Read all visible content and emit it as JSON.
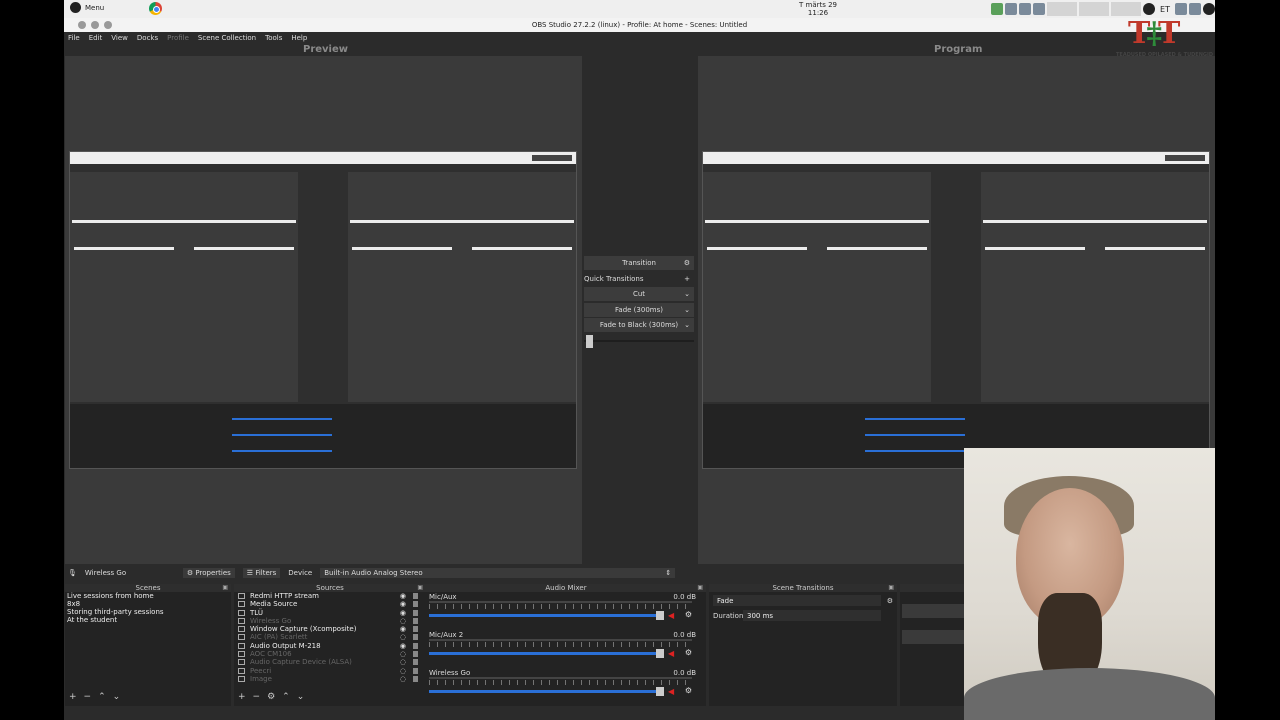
{
  "topbar": {
    "menu_label": "Menu",
    "clock_date": "T märts 29",
    "clock_time": "11:26",
    "lang": "ET"
  },
  "window": {
    "title": "OBS Studio 27.2.2 (linux) - Profile: At home - Scenes: Untitled"
  },
  "menu": [
    "File",
    "Edit",
    "View",
    "Docks",
    "Profile",
    "Scene Collection",
    "Tools",
    "Help"
  ],
  "labels": {
    "preview": "Preview",
    "program": "Program"
  },
  "transition_panel": {
    "transition": "Transition",
    "quick_transitions": "Quick Transitions",
    "cut": "Cut",
    "fade": "Fade (300ms)",
    "fade_black": "Fade to Black (300ms)"
  },
  "source_bar": {
    "source_name": "Wireless Go",
    "properties": "Properties",
    "filters": "Filters",
    "device_label": "Device",
    "device_value": "Built-in Audio Analog Stereo"
  },
  "scenes": {
    "title": "Scenes",
    "items": [
      "Live sessions from home",
      "8x8",
      "Storing third-party sessions",
      "At the student"
    ]
  },
  "sources": {
    "title": "Sources",
    "items": [
      {
        "name": "Redmi HTTP stream",
        "visible": true
      },
      {
        "name": "Media Source",
        "visible": true
      },
      {
        "name": "TLÜ",
        "visible": true
      },
      {
        "name": "Wireless Go",
        "visible": false
      },
      {
        "name": "Window Capture (Xcomposite)",
        "visible": true
      },
      {
        "name": "AIC (PA) Scarlett",
        "visible": false
      },
      {
        "name": "Audio Output M-218",
        "visible": true
      },
      {
        "name": "AOC CM106",
        "visible": false
      },
      {
        "name": "Audio Capture Device (ALSA)",
        "visible": false
      },
      {
        "name": "Peecri",
        "visible": false
      },
      {
        "name": "Image",
        "visible": false
      }
    ]
  },
  "audio_mixer": {
    "title": "Audio Mixer",
    "channels": [
      {
        "name": "Mic/Aux",
        "db": "0.0 dB"
      },
      {
        "name": "Mic/Aux 2",
        "db": "0.0 dB"
      },
      {
        "name": "Wireless Go",
        "db": "0.0 dB"
      }
    ]
  },
  "scene_transitions": {
    "title": "Scene Transitions",
    "type": "Fade",
    "duration_label": "Duration",
    "duration_value": "300 ms"
  },
  "logo": {
    "caption": "TEADUSED OPILASED & TUDENGID"
  }
}
